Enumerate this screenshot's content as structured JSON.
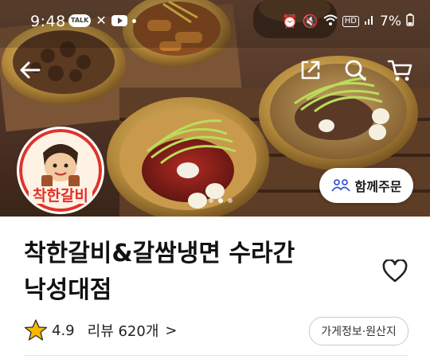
{
  "status_bar": {
    "time": "9:48",
    "talk_badge": "TALK",
    "battery": "7%"
  },
  "store": {
    "name_line1": "착한갈비&갈쌈냉면 수라간",
    "name_line2": "낙성대점",
    "logo_text": "착한갈비",
    "rating": "4.9",
    "reviews_label": "리뷰 620개",
    "reviews_chevron": ">"
  },
  "buttons": {
    "group_order": "함께주문",
    "store_info": "가게정보·원산지"
  },
  "carousel": {
    "total": 3,
    "active_index": 1
  },
  "icons": [
    "back-arrow-icon",
    "share-icon",
    "search-icon",
    "cart-icon",
    "people-icon",
    "heart-icon",
    "star-icon",
    "chevron-right-icon"
  ],
  "colors": {
    "star": "#F5B800",
    "logo_red": "#E0332B"
  }
}
